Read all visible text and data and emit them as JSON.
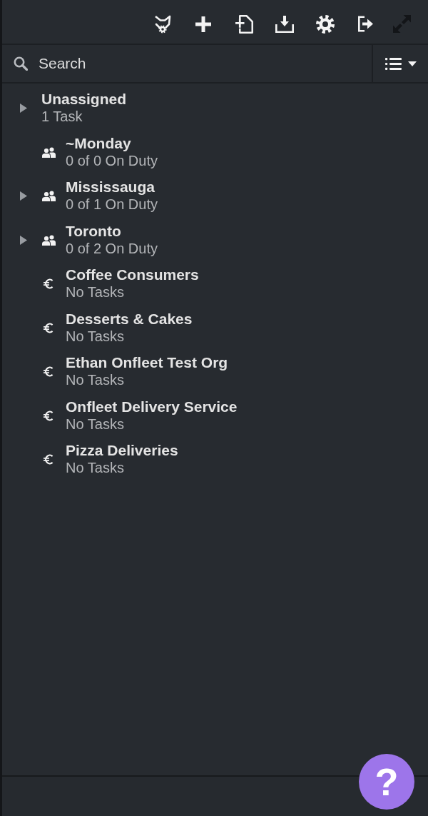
{
  "toolbar": [
    {
      "kind": "logo",
      "disabled": false
    },
    {
      "kind": "add",
      "disabled": false
    },
    {
      "kind": "new_document",
      "disabled": false
    },
    {
      "kind": "download",
      "disabled": false
    },
    {
      "kind": "settings",
      "disabled": false
    },
    {
      "kind": "logout",
      "disabled": false
    },
    {
      "kind": "expand",
      "disabled": true
    }
  ],
  "search": {
    "placeholder": "Search"
  },
  "groups": [
    {
      "kind": "unassigned",
      "name": "Unassigned",
      "summary": "1 Task",
      "expandable": true
    },
    {
      "kind": "team",
      "name": "~Monday",
      "summary": "0 of 0 On Duty",
      "expandable": false
    },
    {
      "kind": "team",
      "name": "Mississauga",
      "summary": "0 of 1 On Duty",
      "expandable": true
    },
    {
      "kind": "team",
      "name": "Toronto",
      "summary": "0 of 2 On Duty",
      "expandable": true
    },
    {
      "kind": "organization",
      "name": "Coffee Consumers",
      "summary": "No Tasks",
      "expandable": false
    },
    {
      "kind": "organization",
      "name": "Desserts & Cakes",
      "summary": "No Tasks",
      "expandable": false
    },
    {
      "kind": "organization",
      "name": "Ethan Onfleet Test Org",
      "summary": "No Tasks",
      "expandable": false
    },
    {
      "kind": "organization",
      "name": "Onfleet Delivery Service",
      "summary": "No Tasks",
      "expandable": false
    },
    {
      "kind": "organization",
      "name": "Pizza Deliveries",
      "summary": "No Tasks",
      "expandable": false
    }
  ],
  "help": {
    "label": "?"
  }
}
